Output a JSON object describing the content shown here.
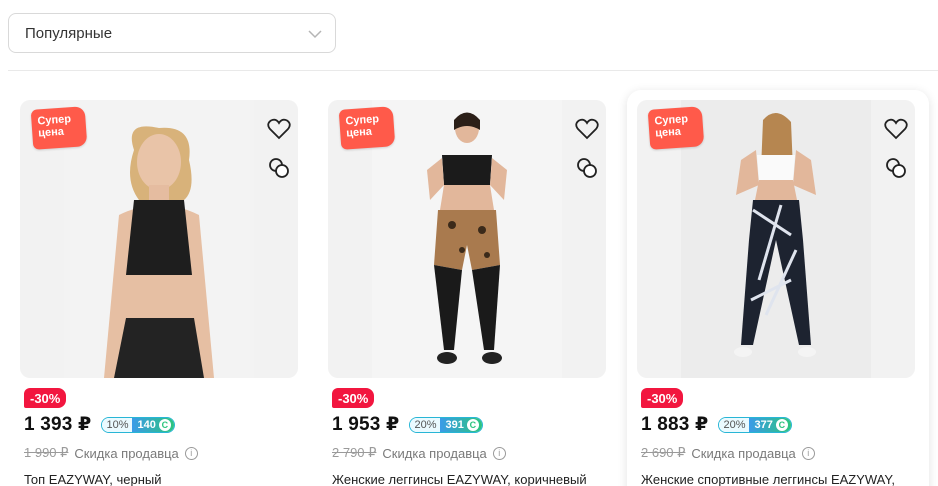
{
  "sort": {
    "selected": "Популярные"
  },
  "colors": {
    "accent": "#f2163f",
    "super": "#ff5a4a"
  },
  "icons": {
    "heart": "heart-icon",
    "compare": "compare-icon",
    "chevron": "chevron-down-icon",
    "info": "info-icon"
  },
  "products": [
    {
      "badge_line1": "Супер",
      "badge_line2": "цена",
      "discount": "-30%",
      "price": "1 393 ₽",
      "bonus_percent": "10%",
      "bonus_points": "140",
      "bonus_symbol": "С",
      "old_price": "1 990 ₽",
      "seller_discount": "Скидка продавца",
      "info_symbol": "i",
      "title": "Топ EAZYWAY, черный"
    },
    {
      "badge_line1": "Супер",
      "badge_line2": "цена",
      "discount": "-30%",
      "price": "1 953 ₽",
      "bonus_percent": "20%",
      "bonus_points": "391",
      "bonus_symbol": "С",
      "old_price": "2 790 ₽",
      "seller_discount": "Скидка продавца",
      "info_symbol": "i",
      "title": "Женские леггинсы EAZYWAY, коричневый"
    },
    {
      "badge_line1": "Супер",
      "badge_line2": "цена",
      "discount": "-30%",
      "price": "1 883 ₽",
      "bonus_percent": "20%",
      "bonus_points": "377",
      "bonus_symbol": "С",
      "old_price": "2 690 ₽",
      "seller_discount": "Скидка продавца",
      "info_symbol": "i",
      "title": "Женские спортивные леггинсы EAZYWAY,"
    }
  ]
}
